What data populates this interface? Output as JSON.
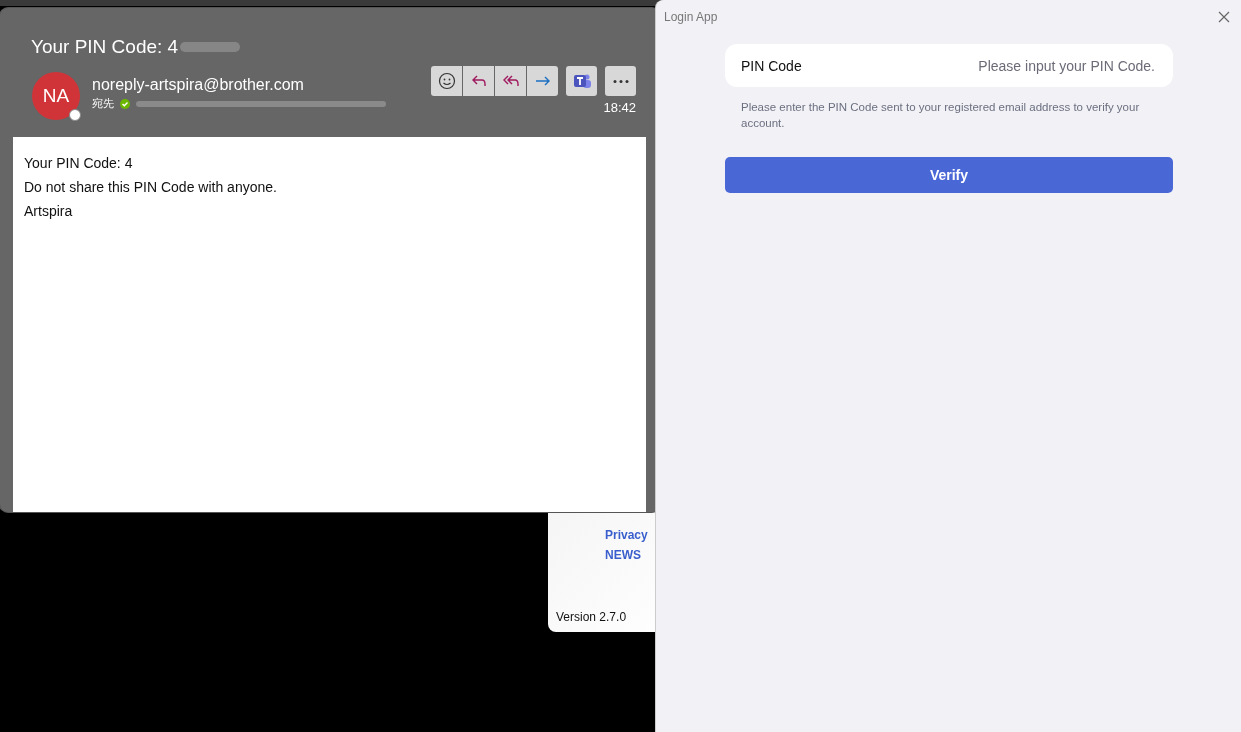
{
  "email": {
    "subject": "Your PIN Code: 4",
    "avatar": "NA",
    "sender": "noreply-artspira@brother.com",
    "to_label": "宛先",
    "time": "18:42",
    "body": [
      "Your PIN Code: 4",
      "Do not share this PIN Code with anyone.",
      "Artspira"
    ]
  },
  "back_window": {
    "links": [
      "Privacy",
      "NEWS"
    ],
    "version": "Version 2.7.0"
  },
  "login": {
    "title": "Login App",
    "field": {
      "label": "PIN Code",
      "placeholder": "Please input your PIN Code."
    },
    "hint": "Please enter the PIN Code sent to your registered email address to verify your account.",
    "button": "Verify"
  }
}
